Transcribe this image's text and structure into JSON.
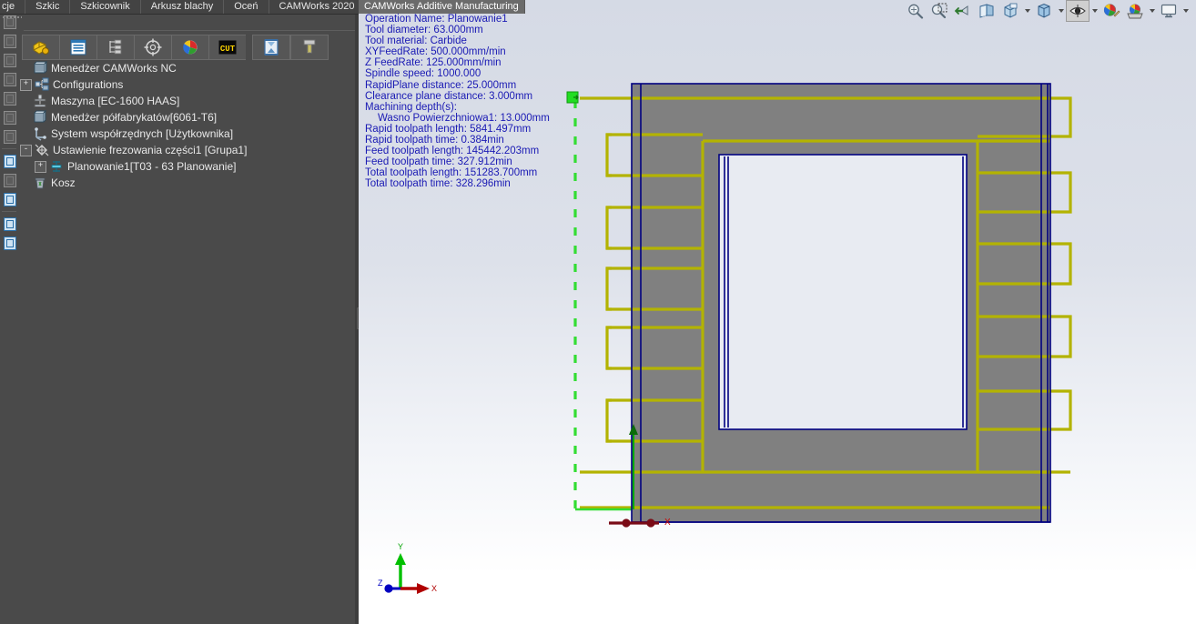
{
  "tabs": [
    {
      "label": "cje",
      "active": false
    },
    {
      "label": "Szkic",
      "active": false
    },
    {
      "label": "Szkicownik",
      "active": false
    },
    {
      "label": "Arkusz blachy",
      "active": false
    },
    {
      "label": "Oceń",
      "active": false
    },
    {
      "label": "CAMWorks 2020",
      "active": false
    },
    {
      "label": "CAMWorks Additive Manufacturing",
      "active": true
    }
  ],
  "doc_tab": "CAMWorks Additive Manufacturing",
  "camworks_toolbar": [
    {
      "name": "extract-machinable-features-icon",
      "label": "Extract Machinable Features"
    },
    {
      "name": "generate-operation-plan-icon",
      "label": "Generate Operation Plan"
    },
    {
      "name": "generate-toolpath-icon",
      "label": "Generate Toolpath"
    },
    {
      "name": "simulate-toolpath-icon",
      "label": "Simulate Toolpath"
    },
    {
      "name": "step-through-toolpath-icon",
      "label": "Step Through Toolpath"
    },
    {
      "name": "post-process-icon",
      "label": "Post Process"
    },
    {
      "name": "save-cam-data-icon",
      "label": "Save CAM Data"
    },
    {
      "name": "tool-crib-icon",
      "label": "Tool Crib"
    }
  ],
  "tree": {
    "root": "Menedżer CAMWorks NC",
    "items": [
      {
        "label": "Configurations",
        "indent": 0,
        "expander": "+",
        "icon": "configurations-icon"
      },
      {
        "label": "Maszyna [EC-1600 HAAS]",
        "indent": 0,
        "expander": "",
        "icon": "machine-icon"
      },
      {
        "label": "Menedżer półfabrykatów[6061-T6]",
        "indent": 0,
        "expander": "",
        "icon": "stock-manager-icon"
      },
      {
        "label": "System współrzędnych [Użytkownika]",
        "indent": 0,
        "expander": "",
        "icon": "coordinate-system-icon"
      },
      {
        "label": "Ustawienie frezowania części1 [Grupa1]",
        "indent": 0,
        "expander": "-",
        "icon": "mill-setup-icon"
      },
      {
        "label": "Planowanie1[T03 - 63 Planowanie]",
        "indent": 1,
        "expander": "+",
        "icon": "face-mill-operation-icon"
      },
      {
        "label": "Kosz",
        "indent": 0,
        "expander": "",
        "icon": "recycle-bin-icon"
      }
    ]
  },
  "operation_info": [
    {
      "text": "Operation Name: Planowanie1",
      "indent": false
    },
    {
      "text": "Tool diameter: 63.000mm",
      "indent": false
    },
    {
      "text": "Tool material: Carbide",
      "indent": false
    },
    {
      "text": "XYFeedRate: 500.000mm/min",
      "indent": false
    },
    {
      "text": "Z FeedRate: 125.000mm/min",
      "indent": false
    },
    {
      "text": "Spindle speed: 1000.000",
      "indent": false
    },
    {
      "text": "RapidPlane distance: 25.000mm",
      "indent": false
    },
    {
      "text": "Clearance plane distance: 3.000mm",
      "indent": false
    },
    {
      "text": "Machining depth(s):",
      "indent": false
    },
    {
      "text": "Wasno Powierzchniowa1: 13.000mm",
      "indent": true
    },
    {
      "text": "Rapid toolpath length: 5841.497mm",
      "indent": false
    },
    {
      "text": "Rapid toolpath time: 0.384min",
      "indent": false
    },
    {
      "text": "Feed toolpath length: 145442.203mm",
      "indent": false
    },
    {
      "text": "Feed toolpath time: 327.912min",
      "indent": false
    },
    {
      "text": "Total toolpath length: 151283.700mm",
      "indent": false
    },
    {
      "text": "Total toolpath time: 328.296min",
      "indent": false
    }
  ],
  "view_toolbar": [
    {
      "name": "zoom-to-fit-icon",
      "caret": false,
      "active": false
    },
    {
      "name": "zoom-to-area-icon",
      "caret": false,
      "active": false
    },
    {
      "name": "previous-view-icon",
      "caret": false,
      "active": false
    },
    {
      "name": "section-view-icon",
      "caret": false,
      "active": false
    },
    {
      "name": "view-orientation-icon",
      "caret": true,
      "active": false
    },
    {
      "name": "display-style-icon",
      "caret": true,
      "active": false
    },
    {
      "name": "hide-show-items-icon",
      "caret": true,
      "active": true
    },
    {
      "name": "edit-appearance-icon",
      "caret": false,
      "active": false
    },
    {
      "name": "apply-scene-icon",
      "caret": true,
      "active": false
    },
    {
      "name": "view-settings-icon",
      "caret": true,
      "active": false
    }
  ],
  "triad": {
    "x": "X",
    "y": "Y",
    "z": "Z"
  },
  "colors": {
    "panel_bg": "#4a4a4a",
    "tab_active": "#6b6b6b",
    "info_text": "#1a1ab4",
    "toolpath_feed": "#b3b300",
    "toolpath_rapid": "#33dd33",
    "part_face": "#808080",
    "part_edge": "#000080",
    "pocket_face": "#e8ebf2",
    "axis_x": "#cc0000",
    "axis_y": "#00aa00",
    "axis_z": "#0000cc"
  },
  "toolpath": {
    "type": "milling-toolpath-preview",
    "left_zigzag_count": 5,
    "right_zigzag_count": 5,
    "origin_marker": "coordinate-origin"
  }
}
